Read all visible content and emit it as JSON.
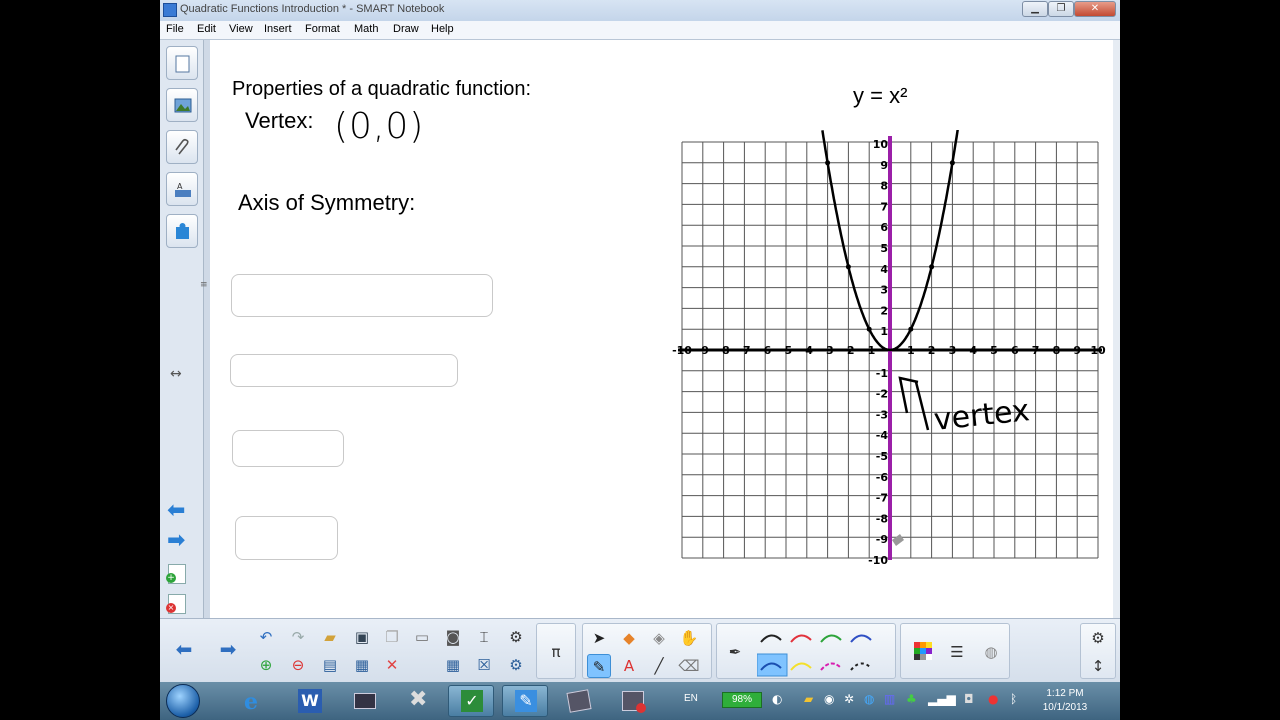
{
  "window": {
    "title": "Quadratic Functions Introduction * - SMART Notebook",
    "minimize": "▁",
    "maximize": "❐",
    "close": "✕"
  },
  "menu": [
    "File",
    "Edit",
    "View",
    "Insert",
    "Format",
    "Math",
    "Draw",
    "Help"
  ],
  "page": {
    "heading": "Properties of a quadratic function:",
    "vertex_label": "Vertex:",
    "vertex_value": "(0,0)",
    "axis_label": "Axis of Symmetry:",
    "graph_title": "y = x²",
    "annotation": "vertex"
  },
  "graph": {
    "x_ticks": [
      "-10",
      "-9",
      "-8",
      "-7",
      "-6",
      "-5",
      "-4",
      "-3",
      "-2",
      "-1",
      "1",
      "2",
      "3",
      "4",
      "5",
      "6",
      "7",
      "8",
      "9",
      "10"
    ],
    "y_ticks": [
      "10",
      "9",
      "8",
      "7",
      "6",
      "5",
      "4",
      "3",
      "2",
      "1",
      "-1",
      "-2",
      "-3",
      "-4",
      "-5",
      "-6",
      "-7",
      "-8",
      "-9",
      "-10"
    ],
    "axis_of_symmetry_color": "#9b1fa8",
    "curve_color": "#000000"
  },
  "taskbar": {
    "language": "EN",
    "battery": "98%",
    "time": "1:12 PM",
    "date": "10/1/2013"
  },
  "toolbar": {
    "math_icon": "π"
  }
}
